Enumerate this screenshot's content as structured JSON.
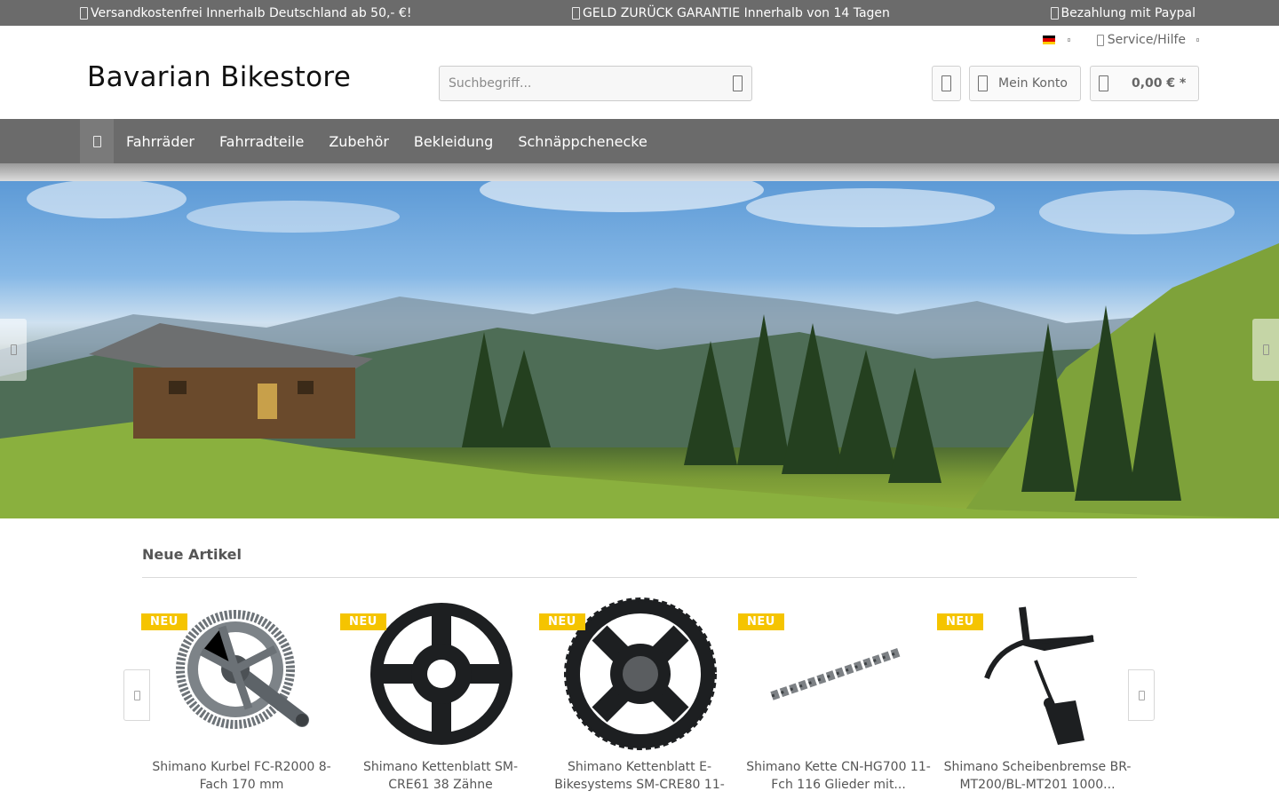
{
  "topbar": {
    "shipping": "Versandkostenfrei Innerhalb Deutschland ab 50,- €!",
    "guarantee": "GELD ZURÜCK GARANTIE Innerhalb von 14 Tagen",
    "payment": "Bezahlung mit Paypal"
  },
  "header": {
    "service": "Service/Hilfe",
    "logo": "Bavarian Bikestore",
    "search_placeholder": "Suchbegriff...",
    "account": "Mein Konto",
    "cart_total": "0,00 € *"
  },
  "nav": {
    "items": [
      "Fahrräder",
      "Fahrradteile",
      "Zubehör",
      "Bekleidung",
      "Schnäppchenecke"
    ]
  },
  "section": {
    "title": "Neue Artikel"
  },
  "products": [
    {
      "badge": "NEU",
      "title": "Shimano Kurbel FC-R2000 8-Fach 170 mm"
    },
    {
      "badge": "NEU",
      "title": "Shimano Kettenblatt SM-CRE61 38 Zähne"
    },
    {
      "badge": "NEU",
      "title": "Shimano Kettenblatt E-Bikesystems SM-CRE80 11-"
    },
    {
      "badge": "NEU",
      "title": "Shimano Kette CN-HG700 11-Fch 116 Glieder mit..."
    },
    {
      "badge": "NEU",
      "title": "Shimano Scheibenbremse BR-MT200/BL-MT201 1000..."
    }
  ],
  "colors": {
    "bar_gray": "#6b6b6b",
    "badge_yellow": "#f5c400"
  }
}
